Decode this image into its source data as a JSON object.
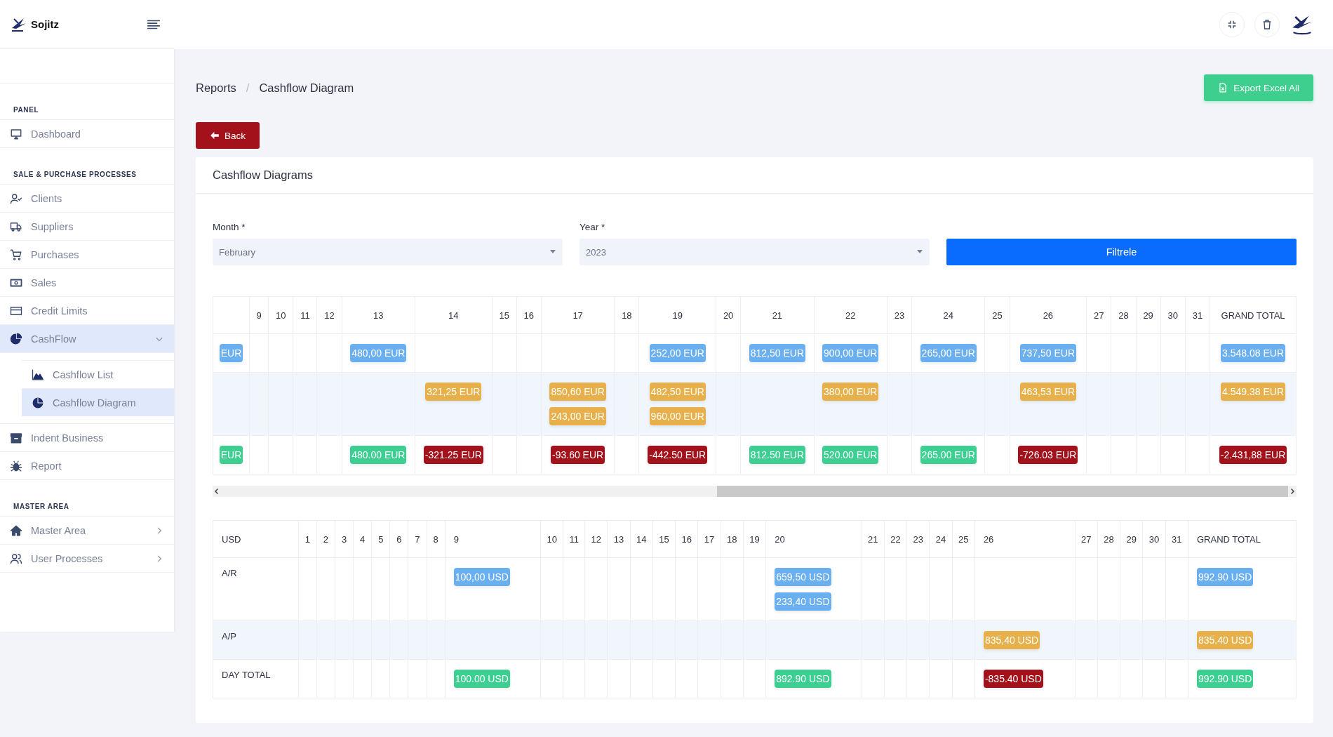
{
  "sidebar": {
    "brand": "Sojitz",
    "sections": [
      {
        "title": "PANEL",
        "items": [
          {
            "label": "Dashboard",
            "selected": false
          }
        ]
      },
      {
        "title": "SALE & PURCHASE PROCESSES",
        "items": [
          {
            "label": "Clients",
            "selected": false
          },
          {
            "label": "Suppliers",
            "selected": false
          },
          {
            "label": "Purchases",
            "selected": false
          },
          {
            "label": "Sales",
            "selected": false
          },
          {
            "label": "Credit Limits",
            "selected": false
          },
          {
            "label": "CashFlow",
            "selected": true,
            "expanded": true,
            "children": [
              {
                "label": "Cashflow List",
                "selected": false
              },
              {
                "label": "Cashflow Diagram",
                "selected": true
              }
            ]
          },
          {
            "label": "Indent Business",
            "selected": false
          },
          {
            "label": "Report",
            "selected": false
          }
        ]
      },
      {
        "title": "MASTER AREA",
        "items": [
          {
            "label": "Master Area",
            "selected": false,
            "expanded": false
          },
          {
            "label": "User Processes",
            "selected": false,
            "expanded": false
          }
        ]
      }
    ]
  },
  "breadcrumb": {
    "items": [
      "Reports",
      "Cashflow Diagram"
    ],
    "separator": "/"
  },
  "actions": {
    "export": "Export Excel All",
    "back": "Back"
  },
  "card": {
    "title": "Cashflow Diagrams",
    "filters": [
      {
        "label": "Month *",
        "value": "February"
      },
      {
        "label": "Year *",
        "value": "2023"
      }
    ],
    "submit": "Filtrele",
    "tables": [
      {
        "columns": [
          "",
          "9",
          "10",
          "11",
          "12",
          "13",
          "14",
          "15",
          "16",
          "17",
          "18",
          "19",
          "20",
          "21",
          "22",
          "23",
          "24",
          "25",
          "26",
          "27",
          "28",
          "29",
          "30",
          "31",
          "GRAND TOTAL"
        ],
        "rows": [
          {
            "cells": [
              [
                {
                  "text": "EUR",
                  "kind": "receivable"
                }
              ],
              [],
              [],
              [],
              [],
              [
                {
                  "text": "480,00 EUR",
                  "kind": "receivable"
                }
              ],
              [],
              [],
              [],
              [],
              [],
              [
                {
                  "text": "252,00 EUR",
                  "kind": "receivable"
                }
              ],
              [],
              [
                {
                  "text": "812,50 EUR",
                  "kind": "receivable"
                }
              ],
              [
                {
                  "text": "900,00 EUR",
                  "kind": "receivable"
                }
              ],
              [],
              [
                {
                  "text": "265,00 EUR",
                  "kind": "receivable"
                }
              ],
              [],
              [
                {
                  "text": "737,50 EUR",
                  "kind": "receivable"
                }
              ],
              [],
              [],
              [],
              [],
              [],
              [
                {
                  "text": "3.548.08 EUR",
                  "kind": "receivable"
                }
              ]
            ]
          },
          {
            "cells": [
              [],
              [],
              [],
              [],
              [],
              [],
              [
                {
                  "text": "321,25 EUR",
                  "kind": "payable"
                }
              ],
              [],
              [],
              [
                {
                  "text": "850,60 EUR",
                  "kind": "payable"
                },
                {
                  "text": "243,00 EUR",
                  "kind": "payable"
                }
              ],
              [],
              [
                {
                  "text": "482,50 EUR",
                  "kind": "payable"
                },
                {
                  "text": "960,00 EUR",
                  "kind": "payable"
                }
              ],
              [],
              [],
              [
                {
                  "text": "380,00 EUR",
                  "kind": "payable"
                }
              ],
              [],
              [],
              [],
              [
                {
                  "text": "463,53 EUR",
                  "kind": "payable"
                }
              ],
              [],
              [],
              [],
              [],
              [],
              [
                {
                  "text": "4.549.38 EUR",
                  "kind": "payable"
                }
              ]
            ]
          },
          {
            "cells": [
              [
                {
                  "text": "EUR",
                  "kind": "gain"
                }
              ],
              [],
              [],
              [],
              [],
              [
                {
                  "text": "480.00 EUR",
                  "kind": "gain"
                }
              ],
              [
                {
                  "text": "-321.25 EUR",
                  "kind": "loss"
                }
              ],
              [],
              [],
              [
                {
                  "text": "-93.60 EUR",
                  "kind": "loss"
                }
              ],
              [],
              [
                {
                  "text": "-442.50 EUR",
                  "kind": "loss"
                }
              ],
              [],
              [
                {
                  "text": "812.50 EUR",
                  "kind": "gain"
                }
              ],
              [
                {
                  "text": "520.00 EUR",
                  "kind": "gain"
                }
              ],
              [],
              [
                {
                  "text": "265.00 EUR",
                  "kind": "gain"
                }
              ],
              [],
              [
                {
                  "text": "-726.03 EUR",
                  "kind": "loss"
                }
              ],
              [],
              [],
              [],
              [],
              [],
              [
                {
                  "text": "-2.431,88 EUR",
                  "kind": "loss"
                }
              ]
            ]
          }
        ]
      },
      {
        "columns": [
          "USD",
          "1",
          "2",
          "3",
          "4",
          "5",
          "6",
          "7",
          "8",
          "9",
          "10",
          "11",
          "12",
          "13",
          "14",
          "15",
          "16",
          "17",
          "18",
          "19",
          "20",
          "21",
          "22",
          "23",
          "24",
          "25",
          "26",
          "27",
          "28",
          "29",
          "30",
          "31",
          "GRAND TOTAL"
        ],
        "rows": [
          {
            "label": "A/R",
            "cells": [
              [],
              [],
              [],
              [],
              [],
              [],
              [],
              [],
              [
                {
                  "text": "100,00 USD",
                  "kind": "receivable"
                }
              ],
              [],
              [],
              [],
              [],
              [],
              [],
              [],
              [],
              [],
              [],
              [
                {
                  "text": "659,50 USD",
                  "kind": "receivable"
                },
                {
                  "text": "233,40 USD",
                  "kind": "receivable"
                }
              ],
              [],
              [],
              [],
              [],
              [],
              [],
              [],
              [],
              [],
              [],
              [],
              [
                {
                  "text": "992.90 USD",
                  "kind": "receivable"
                }
              ]
            ]
          },
          {
            "label": "A/P",
            "cells": [
              [],
              [],
              [],
              [],
              [],
              [],
              [],
              [],
              [],
              [],
              [],
              [],
              [],
              [],
              [],
              [],
              [],
              [],
              [],
              [],
              [],
              [],
              [],
              [],
              [],
              [
                {
                  "text": "835,40 USD",
                  "kind": "payable"
                }
              ],
              [],
              [],
              [],
              [],
              [],
              [
                {
                  "text": "835.40 USD",
                  "kind": "payable"
                }
              ]
            ]
          },
          {
            "label": "DAY TOTAL",
            "cells": [
              [],
              [],
              [],
              [],
              [],
              [],
              [],
              [],
              [
                {
                  "text": "100.00 USD",
                  "kind": "gain"
                }
              ],
              [],
              [],
              [],
              [],
              [],
              [],
              [],
              [],
              [],
              [],
              [
                {
                  "text": "892.90 USD",
                  "kind": "gain"
                }
              ],
              [],
              [],
              [],
              [],
              [],
              [
                {
                  "text": "-835.40 USD",
                  "kind": "loss"
                }
              ],
              [],
              [],
              [],
              [],
              [],
              [
                {
                  "text": "992.90 USD",
                  "kind": "gain"
                }
              ]
            ]
          }
        ]
      }
    ]
  }
}
